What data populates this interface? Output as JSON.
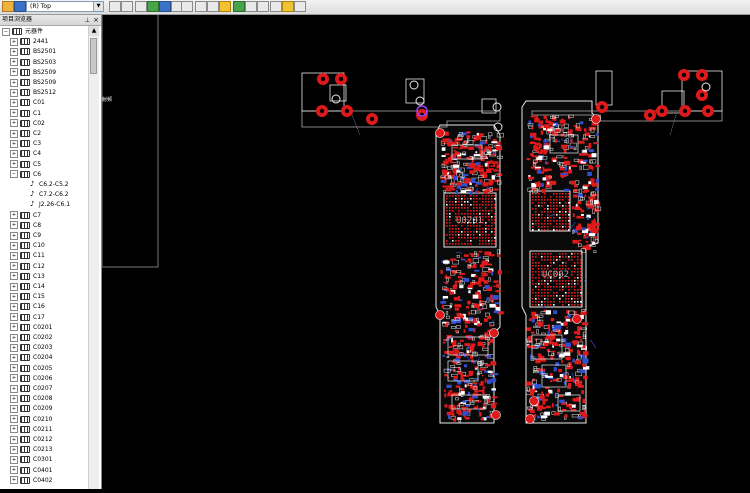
{
  "toolbar": {
    "layer_value": "(R) Top",
    "buttons": [
      "open-icon",
      "save-icon",
      "undo-icon",
      "redo-icon",
      "component-icon",
      "grid-icon",
      "net-icon",
      "route-icon",
      "zoom-in-icon",
      "zoom-out-icon",
      "find-icon",
      "select-icon",
      "flip-icon",
      "layers-icon",
      "measure-icon",
      "pin-icon",
      "window-icon"
    ]
  },
  "panel": {
    "title": "项目浏览器",
    "close": "×",
    "tree": {
      "root": "元器件",
      "items": [
        "2441",
        "BS2501",
        "BS2503",
        "BS2509",
        "BS2509",
        "BS2512",
        "C01",
        "C1",
        "C02",
        "C2",
        "C3",
        "C4",
        "C5",
        "C6"
      ],
      "children_c6": [
        "C6.2-C5.2",
        "C7.2-C6.2",
        "J2.26-C6.1"
      ],
      "items_after": [
        "C7",
        "C8",
        "C9",
        "C10",
        "C11",
        "C12",
        "C13",
        "C14",
        "C15",
        "C16",
        "C17",
        "C0201",
        "C0202",
        "C0203",
        "C0204",
        "C0205",
        "C0206",
        "C0207",
        "C0208",
        "C0209",
        "C0210",
        "C0211",
        "C0212",
        "C0213",
        "C0301",
        "C0401",
        "C0402"
      ]
    }
  },
  "canvas": {
    "chip_labels": [
      "U0201",
      "UC002"
    ],
    "side_note": "射频",
    "colors": {
      "pad": "#e01a1a",
      "outline": "#e8e8e8",
      "trace": "#2f4fd0",
      "silk": "#b0b0b0"
    }
  }
}
